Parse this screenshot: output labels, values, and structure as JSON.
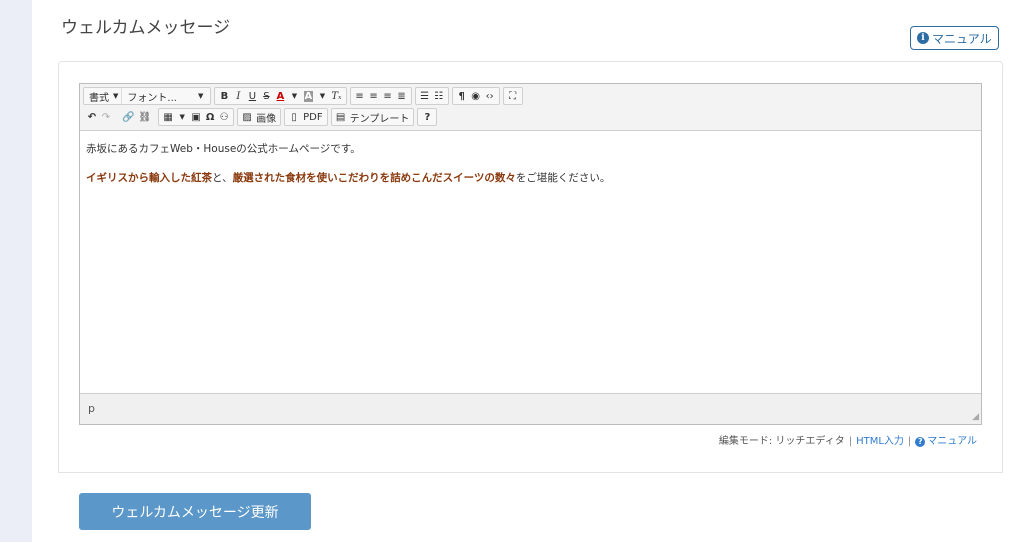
{
  "page": {
    "title": "ウェルカムメッセージ",
    "manual_label": "マニュアル"
  },
  "toolbar": {
    "format_label": "書式",
    "font_label": "フォント...",
    "image_label": "画像",
    "pdf_label": "PDF",
    "template_label": "テンプレート"
  },
  "content": {
    "line1": "赤坂にあるカフェWeb・Houseの公式ホームページです。",
    "line2": {
      "p1": "イギリスから輸入した紅茶",
      "p2": "と、",
      "p3": "厳選された食材を使いこだわりを詰めこんだスイーツの数々",
      "p4": "をご堪能ください。"
    }
  },
  "status_path": "p",
  "mode": {
    "label": "編集モード: リッチエディタ",
    "sep": "|",
    "html_label": "HTML入力",
    "manual_label": "マニュアル"
  },
  "update_button": "ウェルカムメッセージ更新",
  "colors": {
    "accent": "#2e6da4",
    "button": "#5b97c9",
    "text_highlight": "#8b3a0f"
  }
}
